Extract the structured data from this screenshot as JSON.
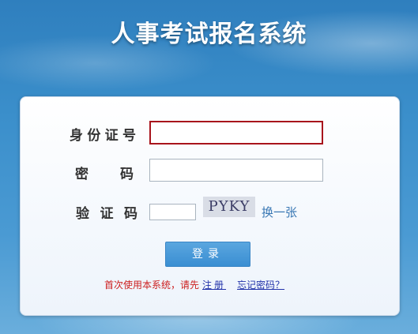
{
  "header": {
    "title": "人事考试报名系统"
  },
  "form": {
    "id_label": "身份证号",
    "id_value": "",
    "password_label": "密 码",
    "password_value": "",
    "captcha_label": "验证码",
    "captcha_value": "",
    "captcha_text": "PYKY",
    "refresh_label": "换一张",
    "login_label": "登录"
  },
  "footer": {
    "prompt_text": "首次使用本系统，请先",
    "register_link": "注册",
    "forgot_link": "忘记密码？"
  },
  "colors": {
    "focus_border": "#a8141c",
    "button": "#3a8ed2",
    "link": "#2233aa",
    "prompt": "#cc1f1f"
  }
}
